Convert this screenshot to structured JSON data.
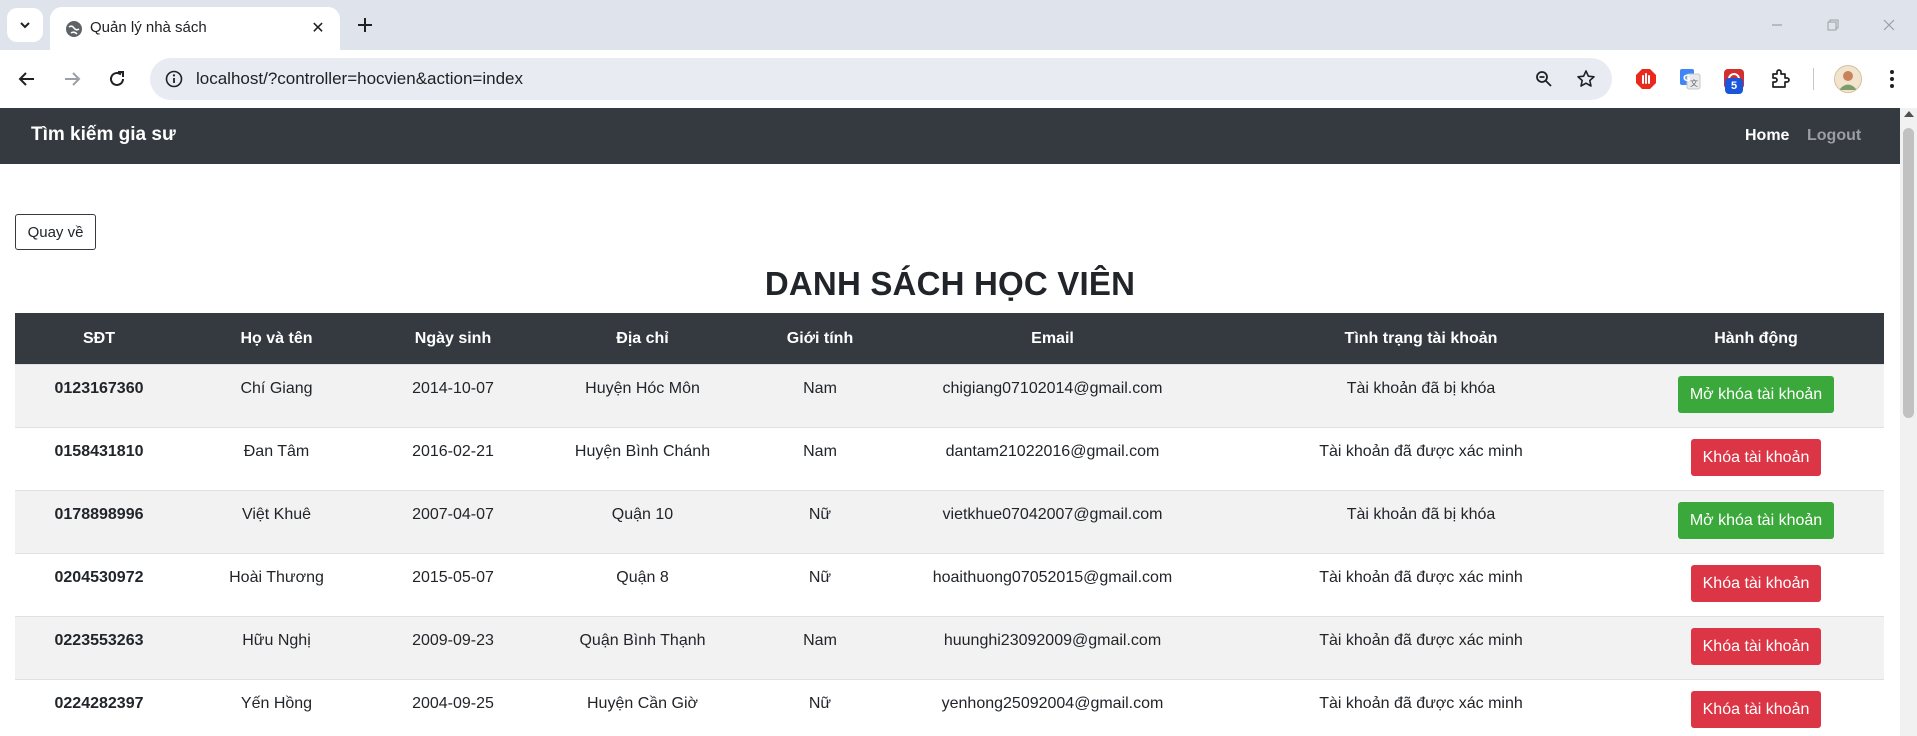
{
  "browser": {
    "tab_title": "Quản lý nhà sách",
    "url": "localhost/?controller=hocvien&action=index",
    "extension_badge": "5"
  },
  "navbar": {
    "brand": "Tìm kiếm gia sư",
    "home": "Home",
    "logout": "Logout"
  },
  "page": {
    "back_button": "Quay về",
    "title": "DANH SÁCH HỌC VIÊN"
  },
  "table": {
    "headers": [
      "SĐT",
      "Họ và tên",
      "Ngày sinh",
      "Địa chỉ",
      "Giới tính",
      "Email",
      "Tình trạng tài khoản",
      "Hành động"
    ],
    "rows": [
      {
        "phone": "0123167360",
        "name": "Chí Giang",
        "dob": "2014-10-07",
        "address": "Huyện Hóc Môn",
        "gender": "Nam",
        "email": "chigiang07102014@gmail.com",
        "status": "Tài khoản đã bị khóa",
        "action": "Mở khóa tài khoản",
        "action_type": "unlock"
      },
      {
        "phone": "0158431810",
        "name": "Đan Tâm",
        "dob": "2016-02-21",
        "address": "Huyện Bình Chánh",
        "gender": "Nam",
        "email": "dantam21022016@gmail.com",
        "status": "Tài khoản đã được xác minh",
        "action": "Khóa tài khoản",
        "action_type": "lock"
      },
      {
        "phone": "0178898996",
        "name": "Việt Khuê",
        "dob": "2007-04-07",
        "address": "Quận 10",
        "gender": "Nữ",
        "email": "vietkhue07042007@gmail.com",
        "status": "Tài khoản đã bị khóa",
        "action": "Mở khóa tài khoản",
        "action_type": "unlock"
      },
      {
        "phone": "0204530972",
        "name": "Hoài Thương",
        "dob": "2015-05-07",
        "address": "Quận 8",
        "gender": "Nữ",
        "email": "hoaithuong07052015@gmail.com",
        "status": "Tài khoản đã được xác minh",
        "action": "Khóa tài khoản",
        "action_type": "lock"
      },
      {
        "phone": "0223553263",
        "name": "Hữu Nghị",
        "dob": "2009-09-23",
        "address": "Quận Bình Thạnh",
        "gender": "Nam",
        "email": "huunghi23092009@gmail.com",
        "status": "Tài khoản đã được xác minh",
        "action": "Khóa tài khoản",
        "action_type": "lock"
      },
      {
        "phone": "0224282397",
        "name": "Yến Hồng",
        "dob": "2004-09-25",
        "address": "Huyện Cần Giờ",
        "gender": "Nữ",
        "email": "yenhong25092004@gmail.com",
        "status": "Tài khoản đã được xác minh",
        "action": "Khóa tài khoản",
        "action_type": "lock"
      }
    ]
  },
  "colors": {
    "navbar_bg": "#343a40",
    "unlock_button": "#3aa83a",
    "lock_button": "#dc3545",
    "stripe": "#f2f2f2"
  }
}
